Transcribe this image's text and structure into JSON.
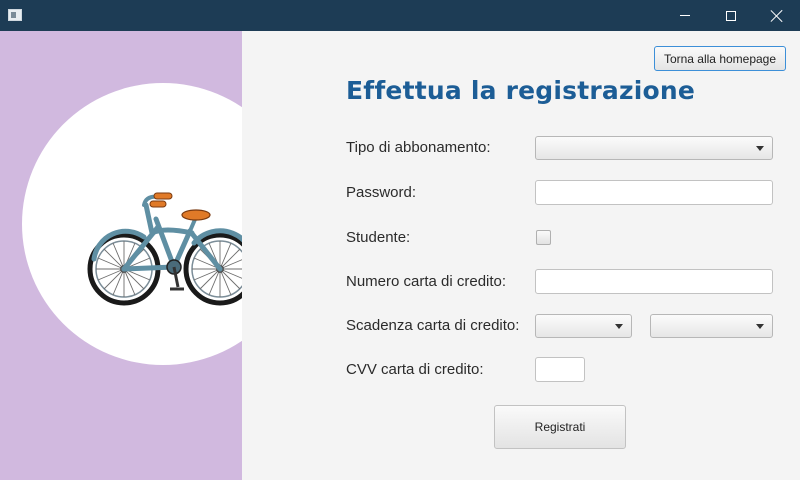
{
  "window": {
    "icons": {
      "app": "window-app-icon",
      "minimize": "minimize-icon",
      "maximize": "maximize-icon",
      "close": "close-icon"
    },
    "titlebar_color": "#1d3c55"
  },
  "sidebar": {
    "background_color": "#d1b9df",
    "image": "bicycle-illustration"
  },
  "header": {
    "home_button_label": "Torna alla homepage",
    "title": "Effettua la registrazione",
    "title_color": "#1c5d96"
  },
  "form": {
    "subscription_type": {
      "label": "Tipo di abbonamento:",
      "value": ""
    },
    "password": {
      "label": "Password:",
      "value": ""
    },
    "student": {
      "label": "Studente:",
      "checked": false
    },
    "card_number": {
      "label": "Numero carta di credito:",
      "value": ""
    },
    "card_expiry": {
      "label": "Scadenza carta di credito:",
      "month_value": "",
      "year_value": ""
    },
    "cvv": {
      "label": "CVV carta di credito:",
      "value": ""
    },
    "submit_label": "Registrati"
  }
}
